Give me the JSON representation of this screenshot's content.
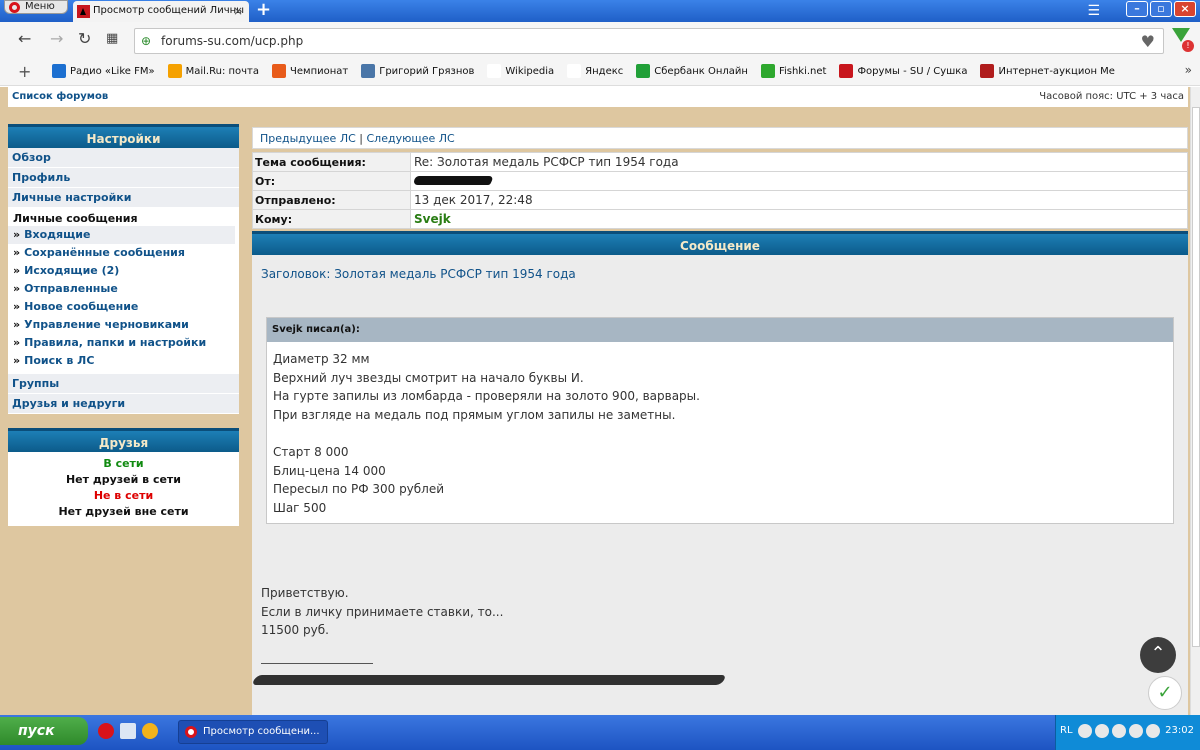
{
  "browser": {
    "menu_label": "Меню",
    "tab_title": "Просмотр сообщений Личны",
    "tab_close": "×",
    "new_tab": "+",
    "url": "forums-su.com/ucp.php"
  },
  "bookmarks": [
    {
      "label": "Радио «Like FM»",
      "icon": "radio-icon",
      "color": "#1c6fd0"
    },
    {
      "label": "Mail.Ru: почта",
      "icon": "mailru-icon",
      "color": "#f5a100"
    },
    {
      "label": "Чемпионат",
      "icon": "championat-icon",
      "color": "#e85b1a"
    },
    {
      "label": "Григорий Грязнов",
      "icon": "vk-icon",
      "color": "#4a76a8"
    },
    {
      "label": "Wikipedia",
      "icon": "wikipedia-icon",
      "color": "#ffffff"
    },
    {
      "label": "Яндекс",
      "icon": "yandex-icon",
      "color": "#ffffff"
    },
    {
      "label": "Сбербанк Онлайн",
      "icon": "sberbank-icon",
      "color": "#21a038"
    },
    {
      "label": "Fishki.net",
      "icon": "fishki-icon",
      "color": "#2ea82e"
    },
    {
      "label": "Форумы - SU / Сушка",
      "icon": "forum-icon",
      "color": "#c8161d"
    },
    {
      "label": "Интернет-аукцион Ме",
      "icon": "auction-icon",
      "color": "#b01c1c"
    }
  ],
  "page": {
    "forum_list": "Список форумов",
    "timezone": "Часовой пояс: UTC + 3 часа"
  },
  "sidebar": {
    "settings_title": "Настройки",
    "items_top": [
      "Обзор",
      "Профиль",
      "Личные настройки"
    ],
    "pm_header": "Личные сообщения",
    "pm_items": [
      "Входящие",
      "Сохранённые сообщения",
      "Исходящие (2)",
      "Отправленные",
      "Новое сообщение",
      "Управление черновиками",
      "Правила, папки и настройки",
      "Поиск в ЛС"
    ],
    "items_bottom": [
      "Группы",
      "Друзья и недруги"
    ],
    "friends_title": "Друзья",
    "online_label": "В сети",
    "no_online": "Нет друзей в сети",
    "offline_label": "Не в сети",
    "no_offline": "Нет друзей вне сети"
  },
  "message": {
    "prev": "Предыдущее ЛС",
    "separator": "|",
    "next": "Следующее ЛС",
    "subject_label": "Тема сообщения:",
    "subject_value": "Re: Золотая медаль РСФСР тип 1954 года",
    "from_label": "От:",
    "sent_label": "Отправлено:",
    "sent_value": "13 дек 2017, 22:48",
    "to_label": "Кому:",
    "to_value": "Svejk",
    "section_title": "Сообщение",
    "body_subject": "Заголовок: Золотая медаль РСФСР тип 1954 года",
    "quote_author": "Svejk писал(а):",
    "quote_lines": [
      "Диаметр 32 мм",
      "Верхний луч звезды смотрит на начало буквы И.",
      "На гурте запилы из ломбарда - проверяли на золото 900, варвары.",
      "При взгляде на медаль под прямым углом запилы не заметны.",
      "",
      "Старт 8 000",
      "Блиц-цена 14 000",
      "Пересыл по РФ 300 рублей",
      "Шаг 500"
    ],
    "reply_lines": [
      "Приветствую.",
      "Если в личку принимаете ставки, то...",
      "11500 руб."
    ]
  },
  "taskbar": {
    "start_label": "пуск",
    "task_label": "Просмотр сообщени...",
    "lang": "RL",
    "time": "23:02"
  }
}
